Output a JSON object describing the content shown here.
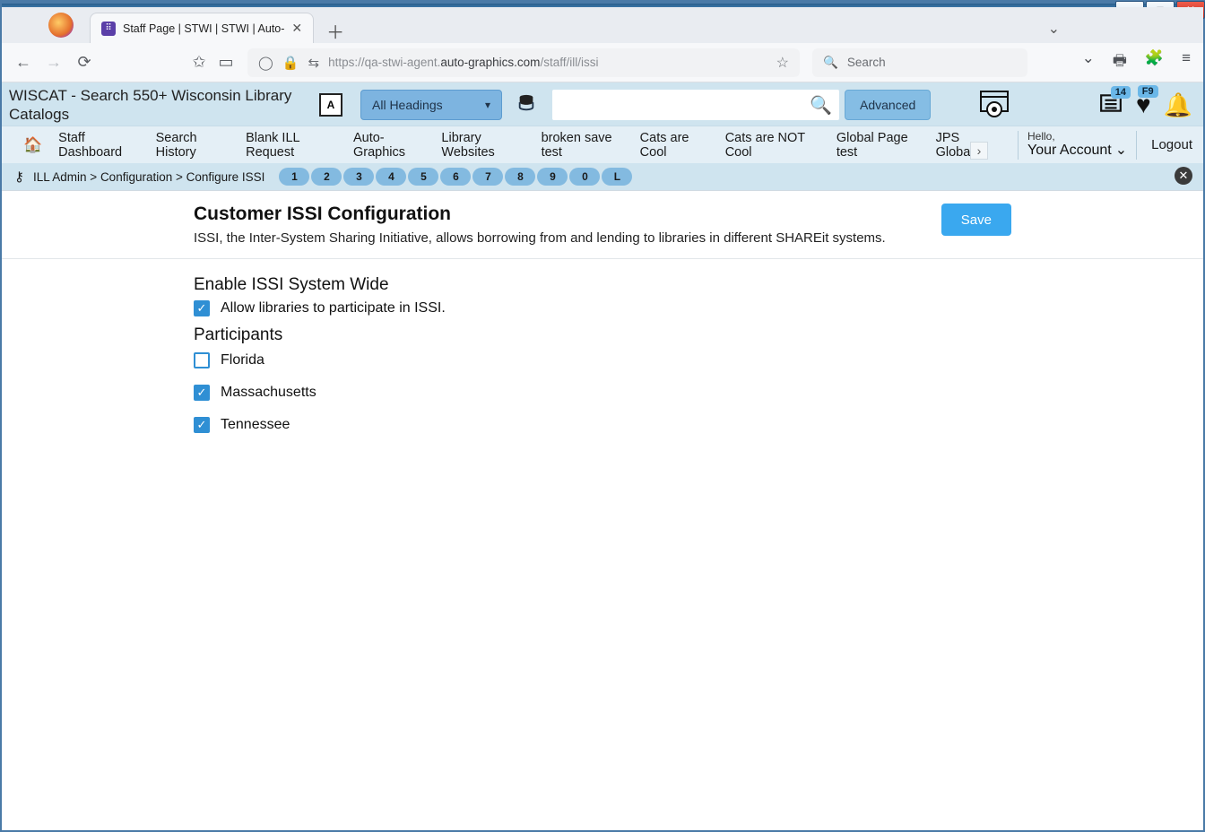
{
  "window": {
    "min": "–",
    "max": "□",
    "close": "✕"
  },
  "browser": {
    "tab_title": "Staff Page | STWI | STWI | Auto-",
    "url_prefix": "https://qa-stwi-agent.",
    "url_bold": "auto-graphics.com",
    "url_suffix": "/staff/ill/issi",
    "search_placeholder": "Search"
  },
  "brand": {
    "title": "WISCAT - Search 550+ Wisconsin Library Catalogs",
    "headings_label": "All Headings",
    "advanced_label": "Advanced",
    "list_count": "14",
    "heart_count": "F9"
  },
  "nav2": {
    "items": [
      "Staff Dashboard",
      "Search History",
      "Blank ILL Request",
      "Auto-Graphics",
      "Library Websites",
      "broken save test",
      "Cats are Cool",
      "Cats are NOT Cool",
      "Global Page test",
      "JPS Global"
    ],
    "hello": "Hello,",
    "account": "Your Account",
    "logout": "Logout"
  },
  "breadcrumb": {
    "part1": "ILL Admin",
    "part2": "Configuration",
    "part3": "Configure ISSI",
    "pages": [
      "1",
      "2",
      "3",
      "4",
      "5",
      "6",
      "7",
      "8",
      "9",
      "0",
      "L"
    ]
  },
  "page": {
    "title": "Customer ISSI Configuration",
    "subtitle": "ISSI, the Inter-System Sharing Initiative, allows borrowing from and lending to libraries in different SHAREit systems.",
    "save": "Save",
    "enable_heading": "Enable ISSI System Wide",
    "allow_label": "Allow libraries to participate in ISSI.",
    "participants_heading": "Participants",
    "participants": [
      {
        "label": "Florida",
        "checked": false
      },
      {
        "label": "Massachusetts",
        "checked": true
      },
      {
        "label": "Tennessee",
        "checked": true
      }
    ]
  }
}
